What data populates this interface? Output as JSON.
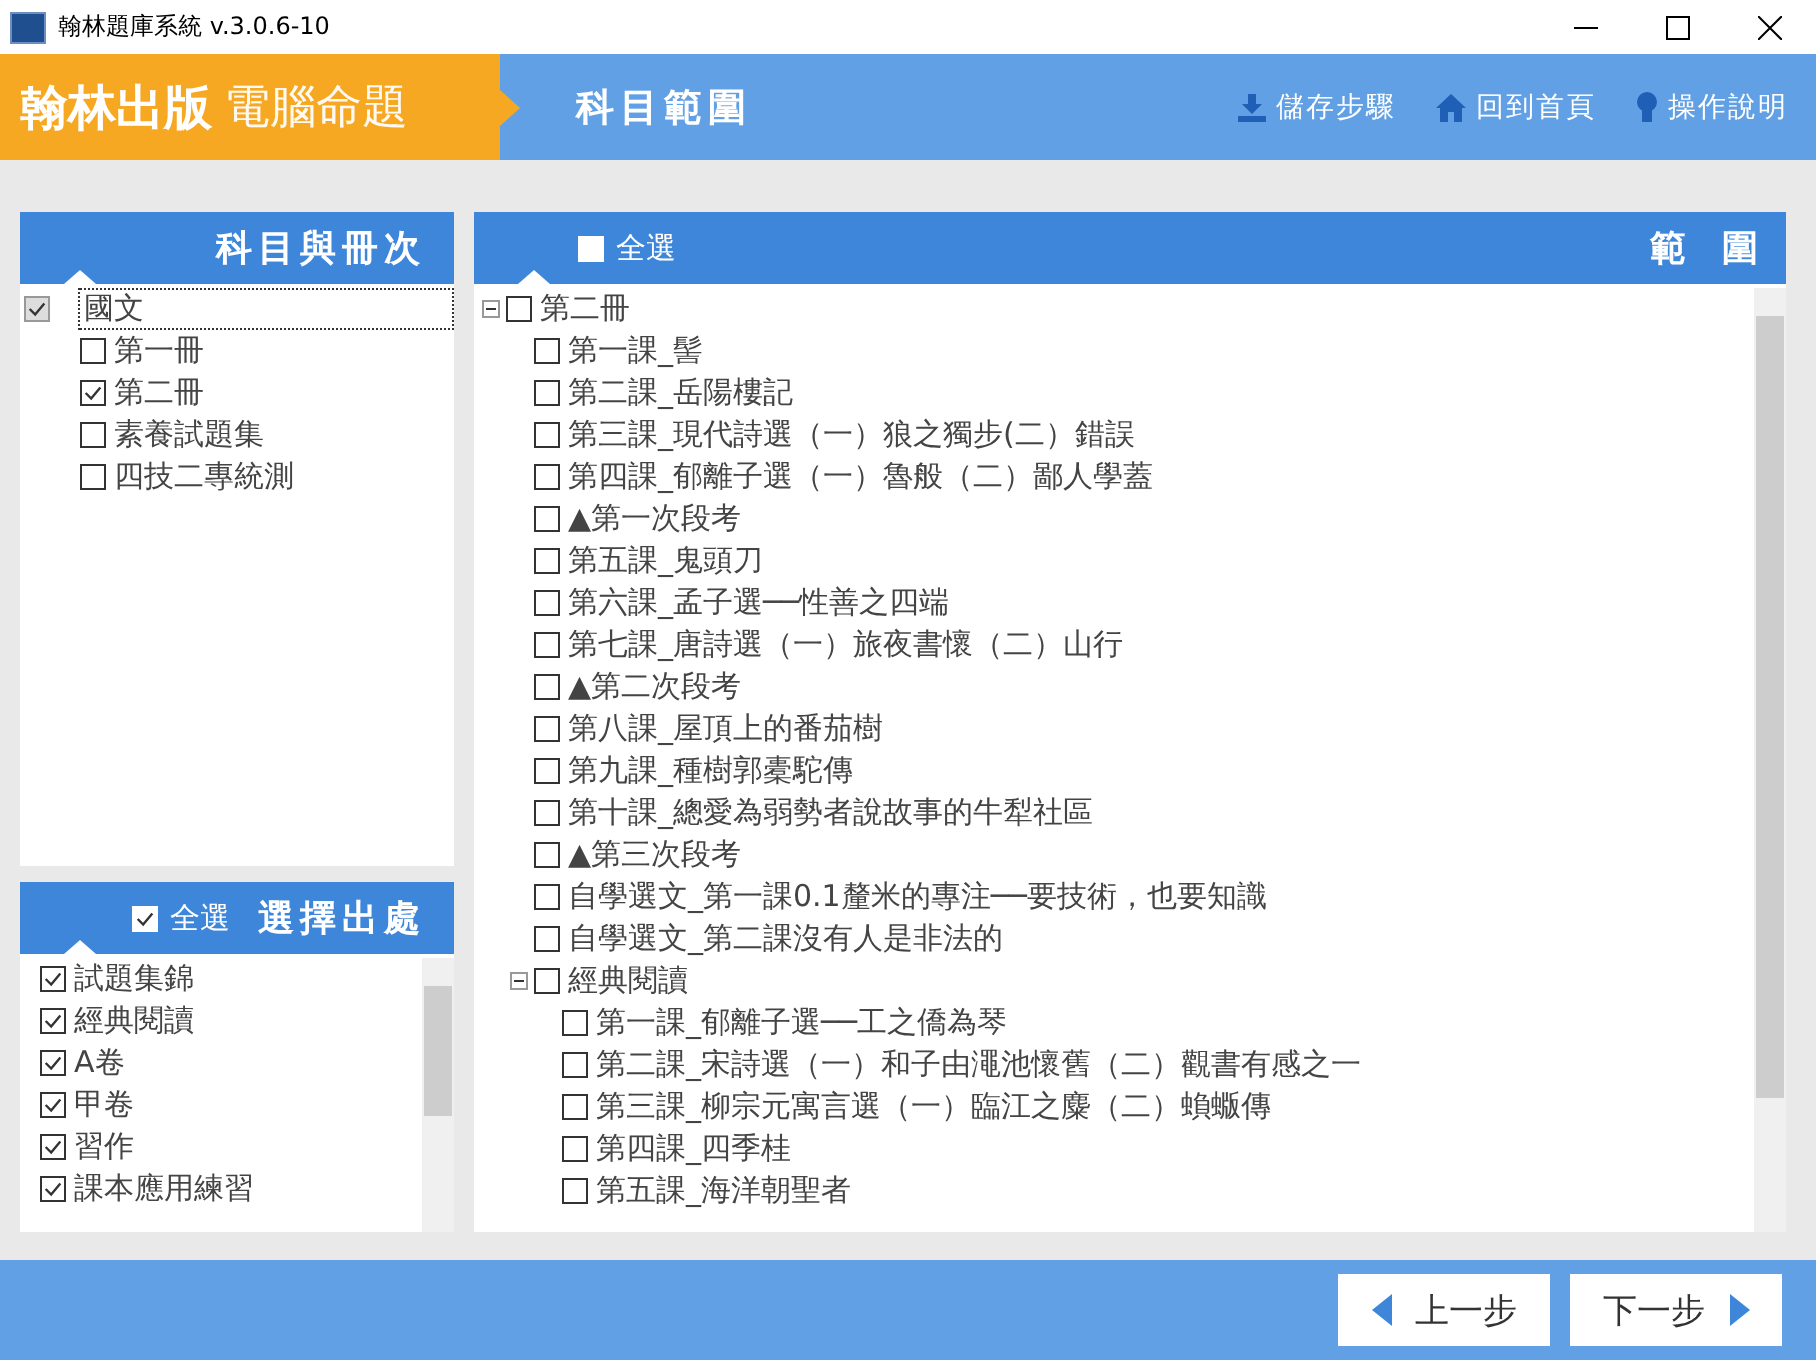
{
  "window": {
    "title": "翰林題庫系統 v.3.0.6-10"
  },
  "header": {
    "brand": "翰林出版",
    "product": "電腦命題",
    "page_title": "科目範圍",
    "actions": [
      {
        "label": "儲存步驟",
        "kind": "download"
      },
      {
        "label": "回到首頁",
        "kind": "home"
      },
      {
        "label": "操作說明",
        "kind": "bulb"
      }
    ]
  },
  "subject_panel": {
    "title": "科目與冊次",
    "tree": [
      {
        "label": "國文",
        "checked": true,
        "selected": true,
        "children": [
          {
            "label": "第一冊",
            "checked": false,
            "selected": false
          },
          {
            "label": "第二冊",
            "checked": true,
            "selected": false
          },
          {
            "label": "素養試題集",
            "checked": false,
            "selected": false
          },
          {
            "label": "四技二專統測",
            "checked": false,
            "selected": false
          }
        ]
      }
    ]
  },
  "source_panel": {
    "title": "選擇出處",
    "select_all": {
      "label": "全選",
      "checked": true
    },
    "items": [
      {
        "label": "試題集錦",
        "checked": true
      },
      {
        "label": "經典閱讀",
        "checked": true
      },
      {
        "label": "A卷",
        "checked": true
      },
      {
        "label": "甲卷",
        "checked": true
      },
      {
        "label": "習作",
        "checked": true
      },
      {
        "label": "課本應用練習",
        "checked": true
      }
    ]
  },
  "range_panel": {
    "title": "範圍",
    "select_all": {
      "label": "全選",
      "checked": false
    },
    "tree": [
      {
        "label": "第二冊",
        "checked": false,
        "expanded": true,
        "children": [
          {
            "label": "第一課_髻",
            "checked": false
          },
          {
            "label": "第二課_岳陽樓記",
            "checked": false
          },
          {
            "label": "第三課_現代詩選（一）狼之獨步(二）錯誤",
            "checked": false
          },
          {
            "label": "第四課_郁離子選（一）魯般（二）鄙人學蓋",
            "checked": false
          },
          {
            "label": "▲第一次段考",
            "checked": false
          },
          {
            "label": "第五課_鬼頭刀",
            "checked": false
          },
          {
            "label": "第六課_孟子選──性善之四端",
            "checked": false
          },
          {
            "label": "第七課_唐詩選（一）旅夜書懷（二）山行",
            "checked": false
          },
          {
            "label": "▲第二次段考",
            "checked": false
          },
          {
            "label": "第八課_屋頂上的番茄樹",
            "checked": false
          },
          {
            "label": "第九課_種樹郭橐駝傳",
            "checked": false
          },
          {
            "label": "第十課_總愛為弱勢者說故事的牛犁社區",
            "checked": false
          },
          {
            "label": "▲第三次段考",
            "checked": false
          },
          {
            "label": "自學選文_第一課0.1釐米的專注──要技術，也要知識",
            "checked": false
          },
          {
            "label": "自學選文_第二課沒有人是非法的",
            "checked": false
          },
          {
            "label": "經典閱讀",
            "checked": false,
            "expanded": true,
            "children": [
              {
                "label": "第一課_郁離子選──工之僑為琴",
                "checked": false
              },
              {
                "label": "第二課_宋詩選（一）和子由澠池懷舊（二）觀書有感之一",
                "checked": false
              },
              {
                "label": "第三課_柳宗元寓言選（一）臨江之麋（二）蝜蝂傳",
                "checked": false
              },
              {
                "label": "第四課_四季桂",
                "checked": false
              },
              {
                "label": "第五課_海洋朝聖者",
                "checked": false
              }
            ]
          }
        ]
      }
    ]
  },
  "footer": {
    "buttons": [
      {
        "label": "上一步",
        "kind": "prev"
      },
      {
        "label": "下一步",
        "kind": "next"
      }
    ]
  }
}
